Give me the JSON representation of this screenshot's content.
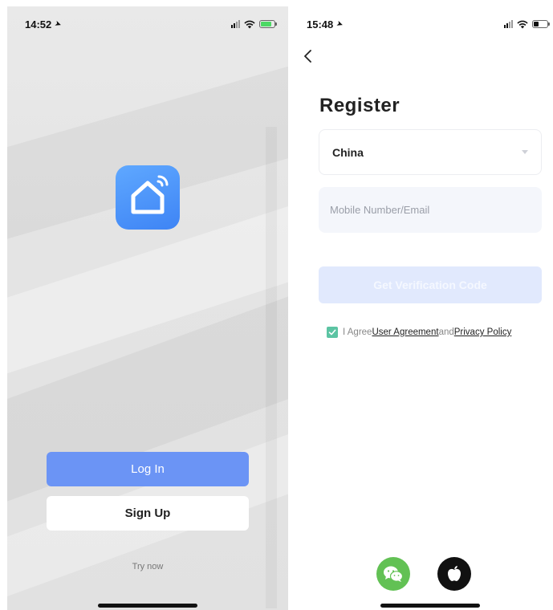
{
  "login_screen": {
    "status": {
      "time": "14:52",
      "battery_color": "#4cd964"
    },
    "app_icon": "smart-home-icon",
    "login_label": "Log In",
    "signup_label": "Sign Up",
    "try_now": "Try now",
    "colors": {
      "primary": "#6b94f5",
      "logo_top": "#5fa8ff",
      "logo_bottom": "#3e84f5"
    }
  },
  "register_screen": {
    "status": {
      "time": "15:48",
      "battery_color": "#111111"
    },
    "title": "Register",
    "country": {
      "value": "China"
    },
    "account_field": {
      "placeholder": "Mobile Number/Email",
      "value": ""
    },
    "verify_label": "Get Verification Code",
    "agreement": {
      "checked": true,
      "prefix": "I Agree",
      "user_agreement": "User Agreement",
      "conjunction": "and",
      "privacy_policy": "Privacy Policy"
    },
    "social": [
      {
        "name": "WeChat",
        "icon": "wechat-icon",
        "color": "#62c154"
      },
      {
        "name": "Apple",
        "icon": "apple-icon",
        "color": "#111111"
      }
    ],
    "colors": {
      "check": "#5cc4a3",
      "disabled_button": "#e1e9fd",
      "field_bg": "#f4f6fb"
    }
  }
}
